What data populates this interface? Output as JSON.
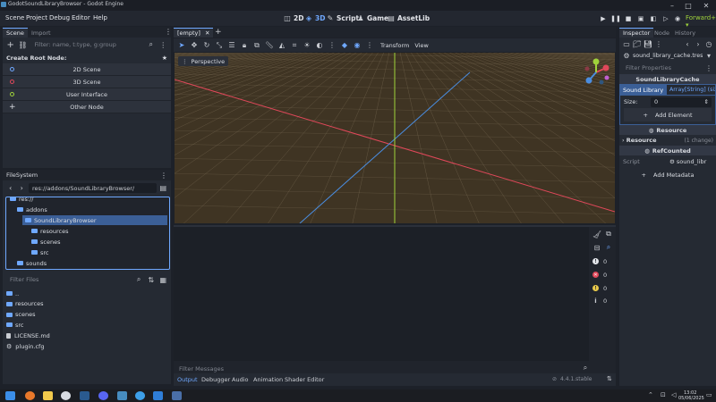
{
  "window": {
    "title": "GodotSoundLibraryBrowser - Godot Engine"
  },
  "menu": [
    "Scene",
    "Project",
    "Debug",
    "Editor",
    "Help"
  ],
  "workspaces": [
    {
      "label": "2D",
      "active": false
    },
    {
      "label": "3D",
      "active": true
    },
    {
      "label": "Script",
      "active": false
    },
    {
      "label": "Game",
      "active": false
    },
    {
      "label": "AssetLib",
      "active": false
    }
  ],
  "renderer": "Forward+",
  "scene_dock": {
    "tabs": [
      "Scene",
      "Import"
    ],
    "filter_placeholder": "Filter: name, t:type, g:group",
    "create_root_label": "Create Root Node:",
    "buttons": [
      "2D Scene",
      "3D Scene",
      "User Interface",
      "Other Node"
    ]
  },
  "filesystem": {
    "title": "FileSystem",
    "path": "res://addons/SoundLibraryBrowser/",
    "tree": [
      {
        "label": "res://",
        "indent": 0
      },
      {
        "label": "addons",
        "indent": 1
      },
      {
        "label": "SoundLibraryBrowser",
        "indent": 2,
        "selected": true
      },
      {
        "label": "resources",
        "indent": 3
      },
      {
        "label": "scenes",
        "indent": 3
      },
      {
        "label": "src",
        "indent": 3
      },
      {
        "label": "sounds",
        "indent": 1
      }
    ],
    "filter_placeholder": "Filter Files",
    "files": [
      {
        "label": "..",
        "kind": "folder"
      },
      {
        "label": "resources",
        "kind": "folder"
      },
      {
        "label": "scenes",
        "kind": "folder"
      },
      {
        "label": "src",
        "kind": "folder"
      },
      {
        "label": "LICENSE.md",
        "kind": "file"
      },
      {
        "label": "plugin.cfg",
        "kind": "gear"
      }
    ]
  },
  "editor": {
    "scene_tab": "[empty]",
    "toolbar_menus": [
      "Transform",
      "View"
    ],
    "perspective_label": "Perspective",
    "gizmo_axes": [
      "X",
      "Y",
      "Z"
    ]
  },
  "output": {
    "filter_placeholder": "Filter Messages",
    "counters": [
      "0",
      "0",
      "0",
      "0"
    ],
    "bottom_tabs": [
      "Output",
      "Debugger",
      "Audio",
      "Animation",
      "Shader Editor"
    ],
    "version": "4.4.1.stable"
  },
  "inspector": {
    "tabs": [
      "Inspector",
      "Node",
      "History"
    ],
    "resource_path": "sound_library_cache.tres",
    "filter_placeholder": "Filter Properties",
    "class_header": "SoundLibraryCache",
    "property_name": "Sound Library",
    "property_value": "Array[String] (siz",
    "size_label": "Size:",
    "size_value": "0",
    "add_element": "Add Element",
    "resource_header": "Resource",
    "resource_group": "Resource",
    "resource_changes": "(1 change)",
    "refcounted_header": "RefCounted",
    "script_label": "Script",
    "script_value": "sound_libr",
    "add_metadata": "Add Metadata"
  },
  "taskbar": {
    "time": "13:02",
    "date": "05/06/2025"
  },
  "colors": {
    "accent": "#6fa8ff",
    "viewport_ground": "#3f3423",
    "x_axis": "#e0485a",
    "z_axis": "#4a8de0",
    "y_axis": "#9fd33b"
  }
}
